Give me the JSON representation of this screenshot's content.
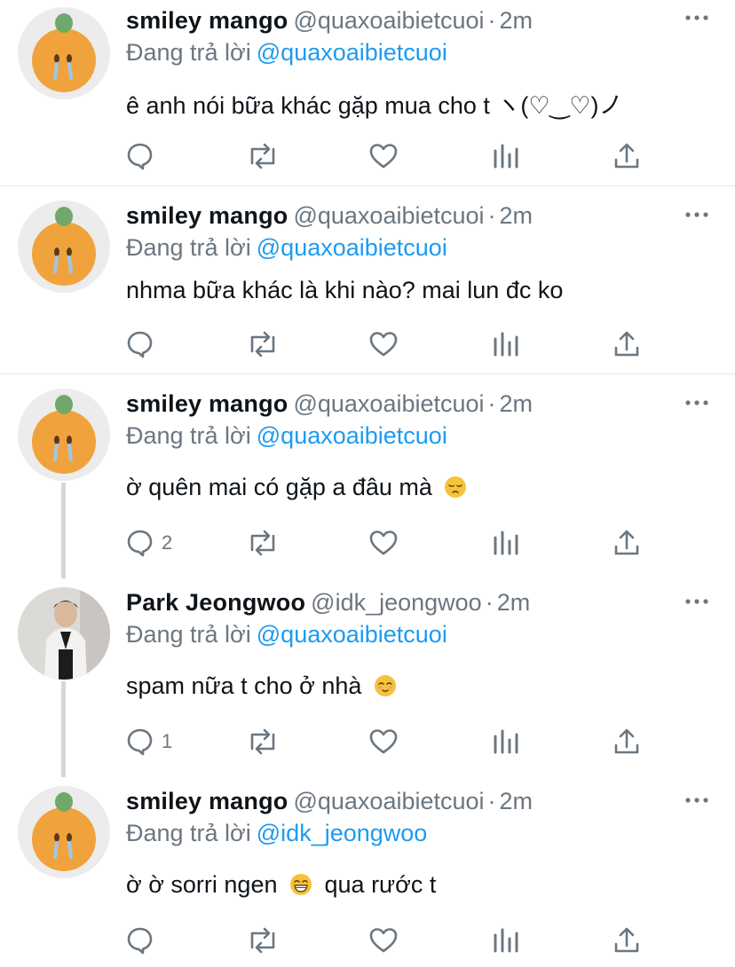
{
  "colors": {
    "link": "#1d9bf0",
    "secondary_text": "#6b7680",
    "divider": "#e1e6ea",
    "thread_line": "#cfd9de",
    "mango": "#f0a33c",
    "leaf": "#6fa86a"
  },
  "icons": {
    "reply": "speech-bubble-icon",
    "retweet": "retweet-icon",
    "like": "heart-icon",
    "analytics": "bar-chart-icon",
    "share": "share-upload-icon",
    "more": "three-dots-icon"
  },
  "tweets": [
    {
      "author": "smiley mango",
      "handle": "@quaxoaibietcuoi",
      "separator": "·",
      "time": "2m",
      "reply_prefix": "Đang trả lời",
      "reply_to": "@quaxoaibietcuoi",
      "text": "ê anh nói bữa khác gặp mua cho t ヽ(♡‿♡)ノ",
      "reply_count": ""
    },
    {
      "author": "smiley mango",
      "handle": "@quaxoaibietcuoi",
      "separator": "·",
      "time": "2m",
      "reply_prefix": "Đang trả lời",
      "reply_to": "@quaxoaibietcuoi",
      "text": "nhma bữa khác là khi nào? mai lun đc ko",
      "reply_count": ""
    },
    {
      "author": "smiley mango",
      "handle": "@quaxoaibietcuoi",
      "separator": "·",
      "time": "2m",
      "reply_prefix": "Đang trả lời",
      "reply_to": "@quaxoaibietcuoi",
      "text": "ờ quên mai có gặp a đâu mà",
      "emoji": "pensive-face-emoji",
      "reply_count": "2"
    },
    {
      "author": "Park Jeongwoo",
      "handle": "@idk_jeongwoo",
      "separator": "·",
      "time": "2m",
      "reply_prefix": "Đang trả lời",
      "reply_to": "@quaxoaibietcuoi",
      "text": "spam nữa t cho ở nhà",
      "emoji": "relieved-face-emoji",
      "reply_count": "1"
    },
    {
      "author": "smiley mango",
      "handle": "@quaxoaibietcuoi",
      "separator": "·",
      "time": "2m",
      "reply_prefix": "Đang trả lời",
      "reply_to": "@idk_jeongwoo",
      "text_before": "ờ ờ sorri ngen",
      "emoji": "grinning-face-emoji",
      "text_after": "qua rước t",
      "reply_count": ""
    }
  ]
}
